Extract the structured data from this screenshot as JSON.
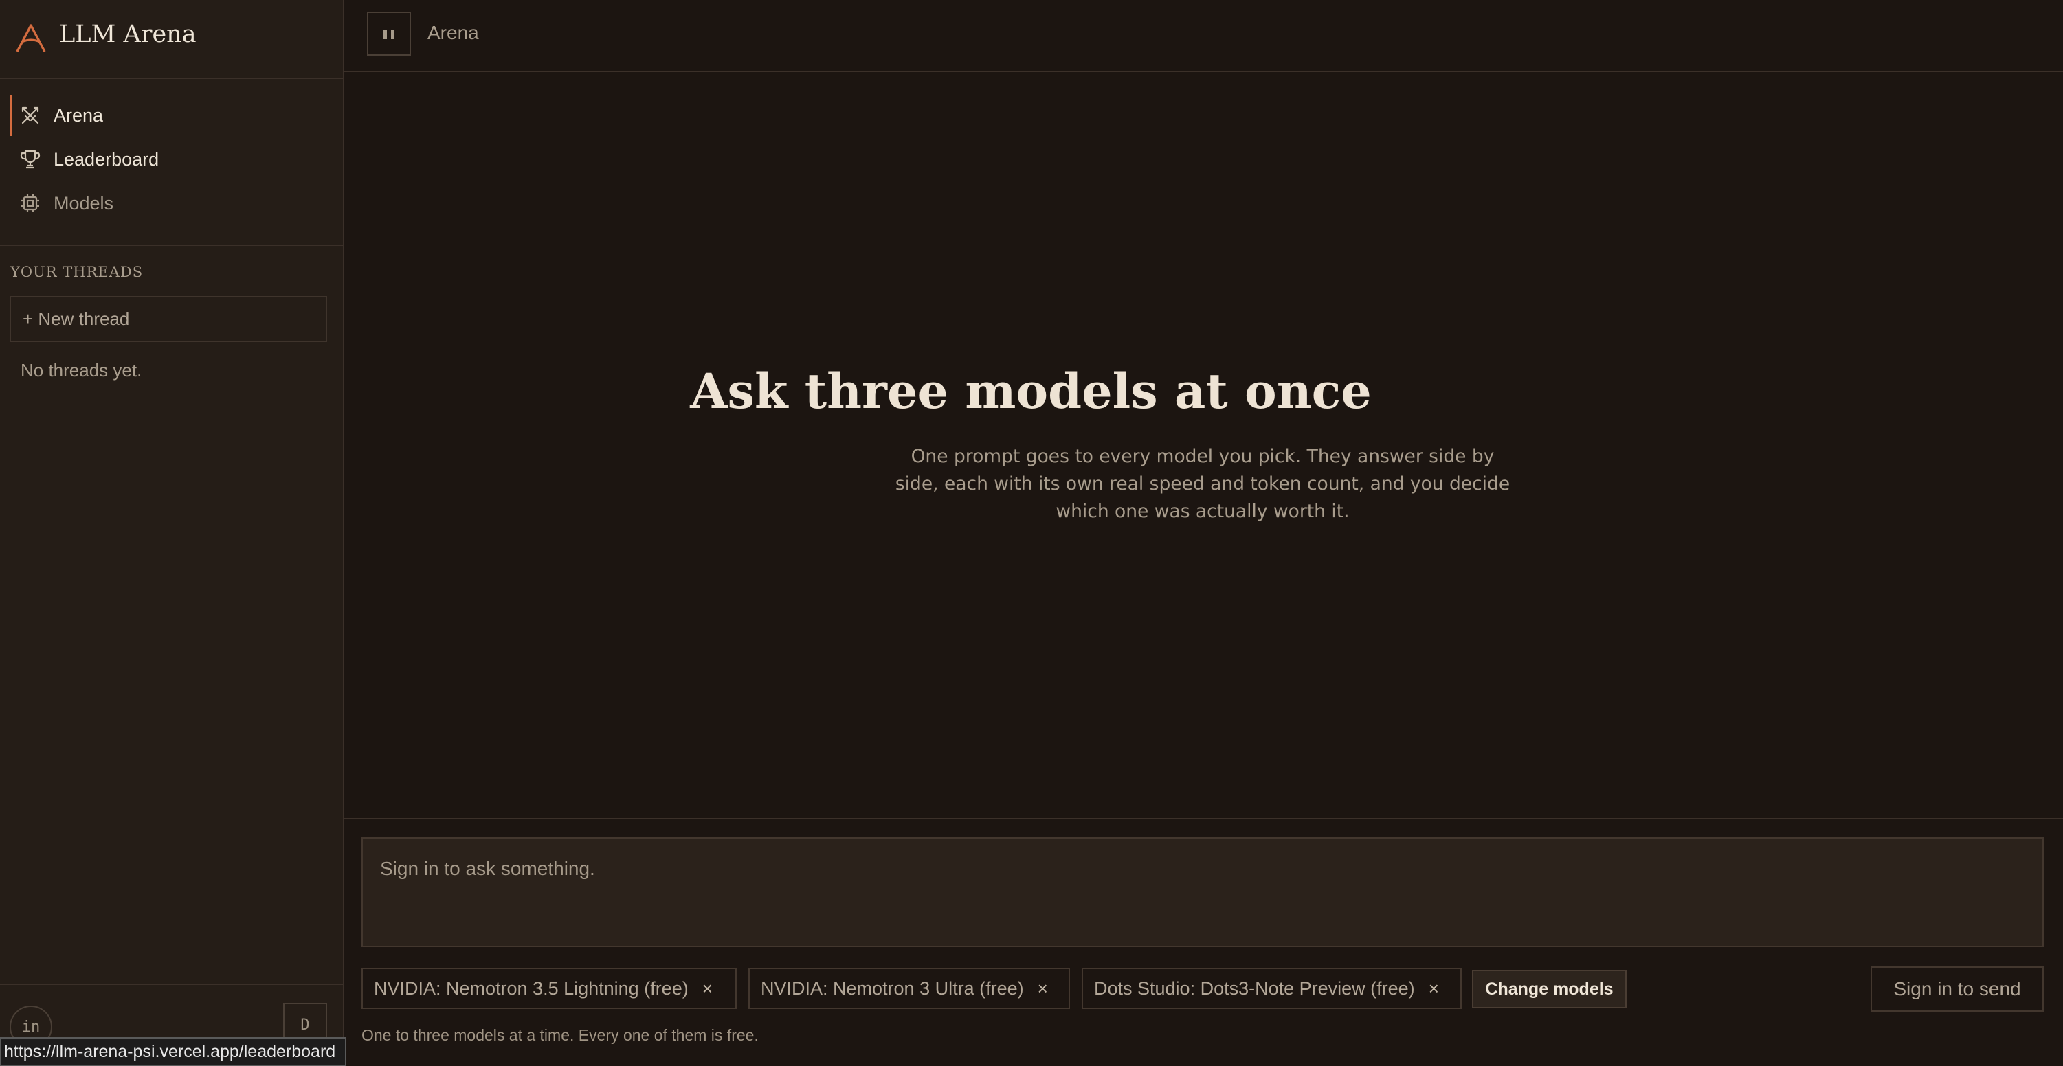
{
  "app": {
    "title": "LLM Arena",
    "logo_icon": "arena-logo-icon",
    "accent": "#d46c3f"
  },
  "sidebar": {
    "nav": [
      {
        "label": "Arena",
        "icon": "crossed-swords-icon",
        "active": true
      },
      {
        "label": "Leaderboard",
        "icon": "trophy-icon",
        "active": false
      },
      {
        "label": "Models",
        "icon": "chip-icon",
        "active": false
      }
    ],
    "threads_heading": "YOUR THREADS",
    "new_thread_label": "+ New thread",
    "empty_text": "No threads yet.",
    "footer": {
      "avatar_text": "in",
      "button_text": "D"
    }
  },
  "topbar": {
    "breadcrumb": "Arena"
  },
  "hero": {
    "title": "Ask three models at once",
    "subtitle": "One prompt goes to every model you pick. They answer side by side, each with its own real speed and token count, and you decide which one was actually worth it."
  },
  "composer": {
    "placeholder": "Sign in to ask something.",
    "models": [
      "NVIDIA: Nemotron 3.5 Lightning (free)",
      "NVIDIA: Nemotron 3 Ultra (free)",
      "Dots Studio: Dots3-Note Preview (free)"
    ],
    "remove_glyph": "×",
    "change_models_label": "Change models",
    "send_label": "Sign in to send",
    "hint": "One to three models at a time. Every one of them is free."
  },
  "status_url": "https://llm-arena-psi.vercel.app/leaderboard"
}
